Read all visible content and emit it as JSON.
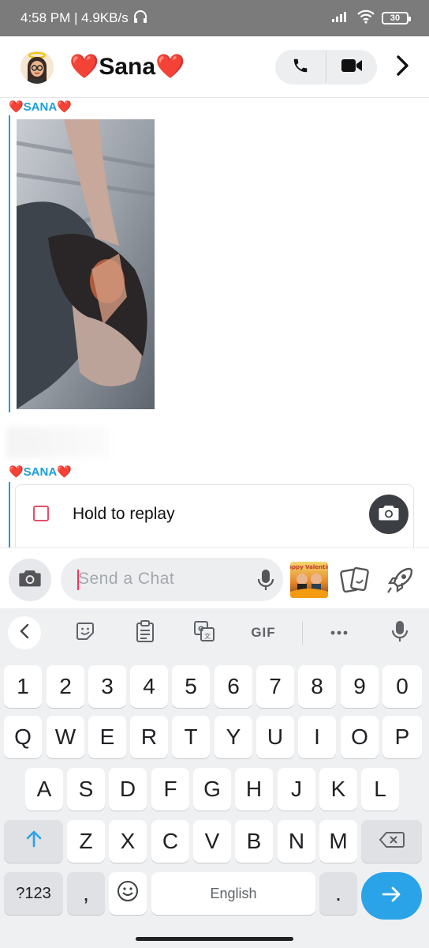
{
  "status_bar": {
    "time_speed": "4:58 PM | 4.9KB/s",
    "battery": "30"
  },
  "header": {
    "contact_name": "❤️Sana❤️"
  },
  "messages": [
    {
      "sender": "❤️SANA❤️"
    },
    {
      "sender": "❤️SANA❤️",
      "replay_text": "Hold to replay"
    }
  ],
  "composer": {
    "placeholder": "Send a Chat",
    "sticker_text": "Happy Valentine"
  },
  "keyboard": {
    "toolbar": [
      "back-icon",
      "sticker-icon",
      "clipboard-icon",
      "translate-icon",
      "GIF",
      "more-icon",
      "mic-icon"
    ],
    "gif_label": "GIF",
    "row_numbers": [
      "1",
      "2",
      "3",
      "4",
      "5",
      "6",
      "7",
      "8",
      "9",
      "0"
    ],
    "row_q": [
      "Q",
      "W",
      "E",
      "R",
      "T",
      "Y",
      "U",
      "I",
      "O",
      "P"
    ],
    "row_a": [
      "A",
      "S",
      "D",
      "F",
      "G",
      "H",
      "J",
      "K",
      "L"
    ],
    "row_z": [
      "Z",
      "X",
      "C",
      "V",
      "B",
      "N",
      "M"
    ],
    "symbols_key": "?123",
    "comma_key": ",",
    "space_label": "English",
    "period_key": "."
  },
  "colors": {
    "accent_blue": "#1c9fd6",
    "checkbox_red": "#e2506b",
    "enter_key": "#2aa3e8"
  }
}
